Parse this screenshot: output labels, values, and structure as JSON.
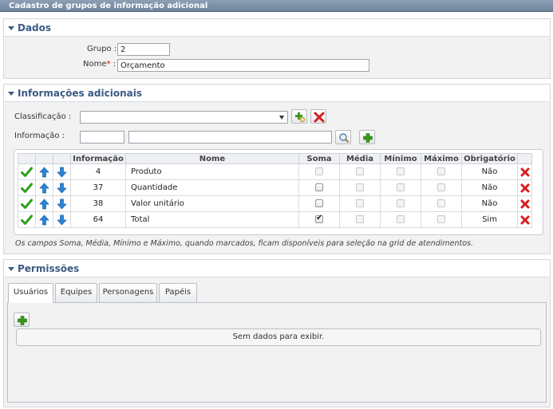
{
  "window": {
    "title": "Cadastro de grupos de informação adicional"
  },
  "dados": {
    "header": "Dados",
    "grupo_label": "Grupo :",
    "grupo_value": "2",
    "nome_label": "Nome",
    "required_mark": "*",
    "nome_colon": " :",
    "nome_value": "Orçamento"
  },
  "info": {
    "header": "Informações adicionais",
    "classificacao_label": "Classificação :",
    "classificacao_value": "",
    "informacao_label": "Informação :",
    "informacao_code": "",
    "informacao_name": "",
    "columns": [
      "",
      "",
      "",
      "Informação",
      "Nome",
      "Soma",
      "Média",
      "Mínimo",
      "Máximo",
      "Obrigatório",
      ""
    ],
    "rows": [
      {
        "codigo": "4",
        "nome": "Produto",
        "soma": false,
        "media": false,
        "minimo": false,
        "maximo": false,
        "obrigatorio": "Não",
        "soma_dim": true
      },
      {
        "codigo": "37",
        "nome": "Quantidade",
        "soma": false,
        "media": false,
        "minimo": false,
        "maximo": false,
        "obrigatorio": "Não",
        "soma_dim": false
      },
      {
        "codigo": "38",
        "nome": "Valor unitário",
        "soma": false,
        "media": false,
        "minimo": false,
        "maximo": false,
        "obrigatorio": "Não",
        "soma_dim": false
      },
      {
        "codigo": "64",
        "nome": "Total",
        "soma": true,
        "media": false,
        "minimo": false,
        "maximo": false,
        "obrigatorio": "Sim",
        "soma_dim": false
      }
    ],
    "note": "Os campos Soma, Média, Mínimo e Máximo, quando marcados, ficam disponíveis para seleção na grid de atendimentos."
  },
  "permissoes": {
    "header": "Permissões",
    "tabs": [
      "Usuários",
      "Equipes",
      "Personagens",
      "Papéis"
    ],
    "active_tab": "Usuários",
    "empty_text": "Sem dados para exibir."
  },
  "icons": {
    "check": "check-icon",
    "up": "arrow-up-icon",
    "down": "arrow-down-icon",
    "delete": "delete-x-icon",
    "add": "add-plus-icon",
    "search": "search-icon",
    "clear": "clear-x-icon"
  },
  "colors": {
    "section_title": "#3b5a84",
    "titlebar": "#7b8ea6",
    "check_green": "#2f9e1b",
    "arrow_blue": "#2a86d8",
    "delete_red": "#d81e1e",
    "add_green": "#3c9b1e"
  }
}
